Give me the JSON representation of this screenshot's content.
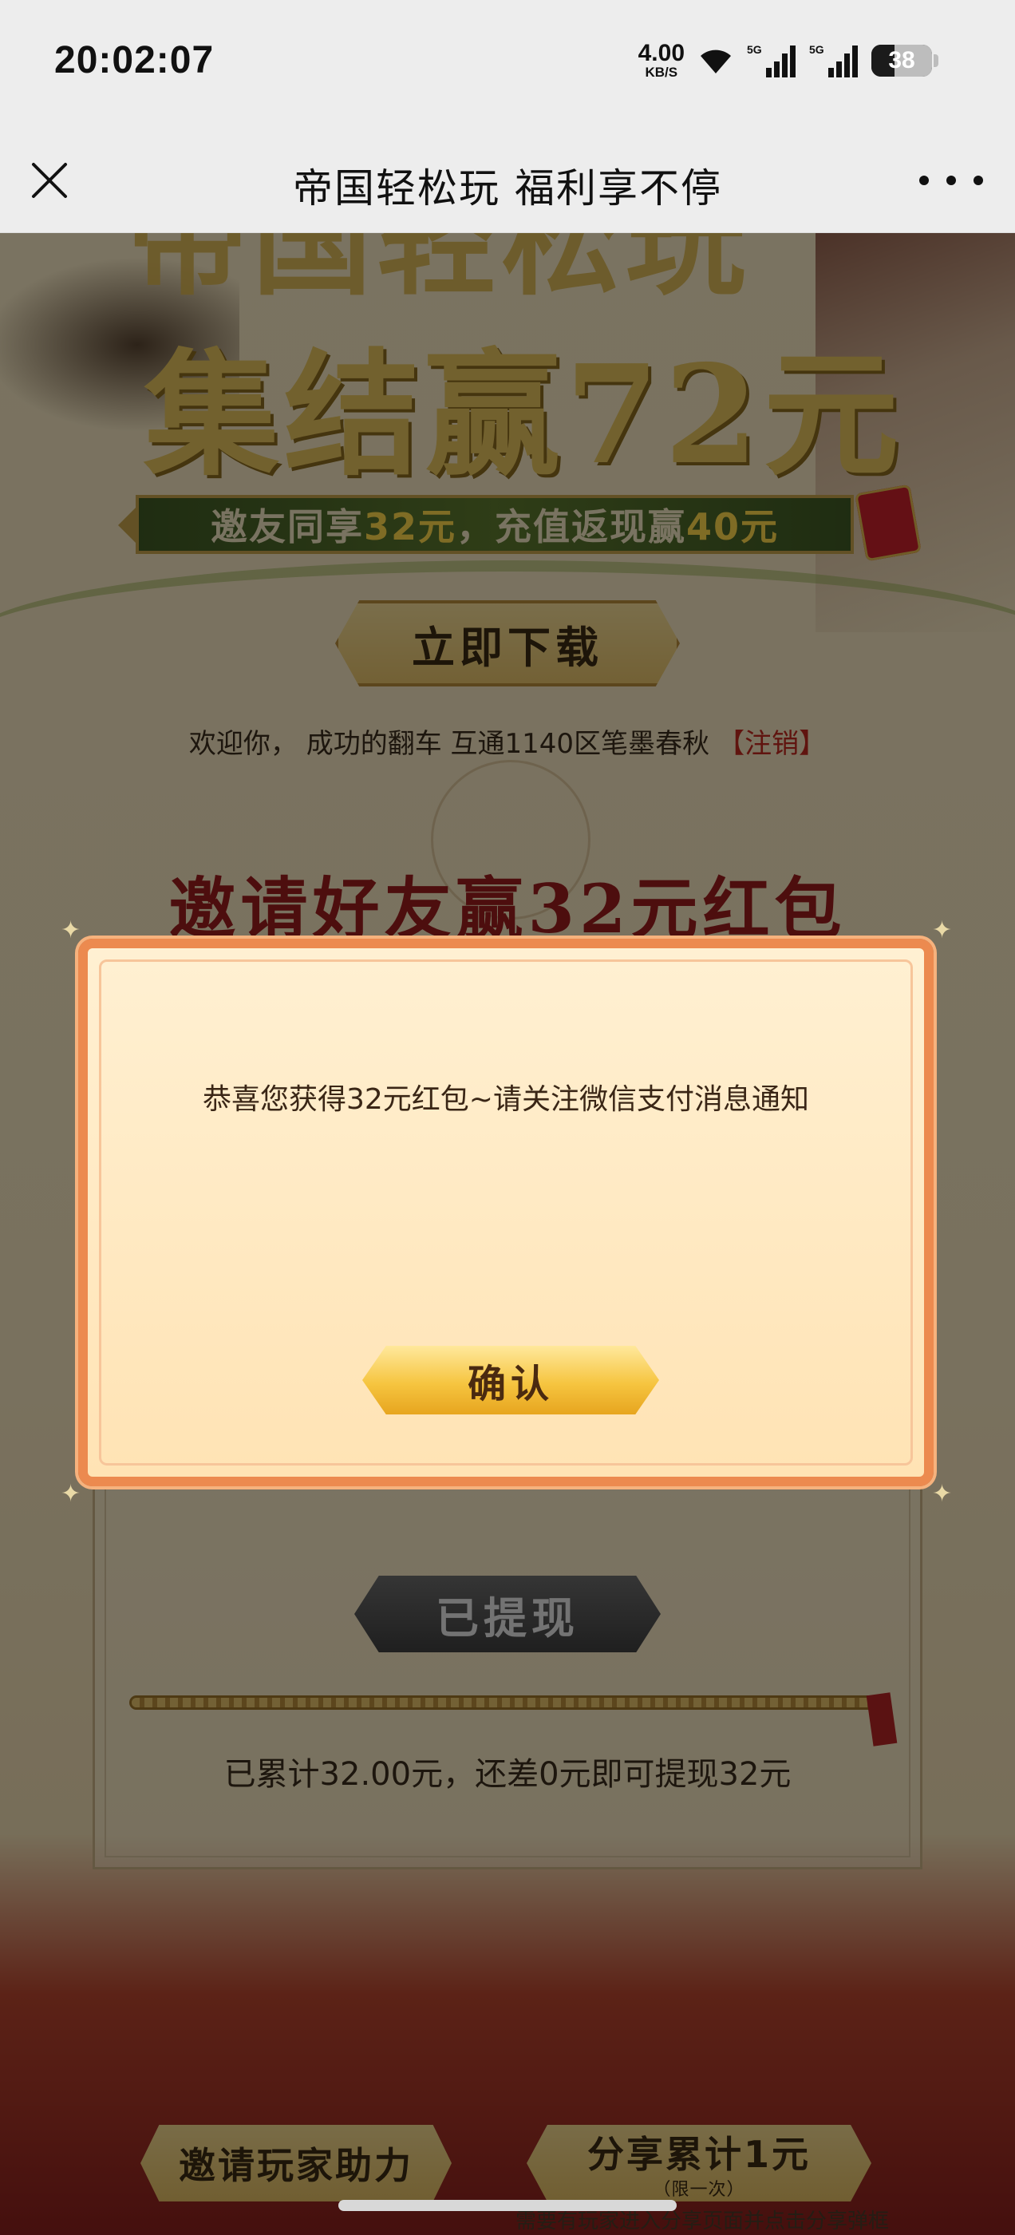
{
  "status_bar": {
    "time": "20:02:07",
    "net_speed_value": "4.00",
    "net_speed_unit": "KB/S",
    "battery": "38",
    "icons": [
      "wifi-icon",
      "signal-5g-icon",
      "signal-5g-icon",
      "battery-icon"
    ]
  },
  "title_bar": {
    "title": "帝国轻松玩 福利享不停",
    "close_icon": "close-icon",
    "more_icon": "more-icon"
  },
  "page": {
    "hero_title_top": "帝国轻松玩",
    "hero_title": "集结赢72元",
    "promo_prefix": "邀友同享",
    "promo_amount1": "32元",
    "promo_middle": "，充值返现赢",
    "promo_amount2": "40元",
    "download_label": "立即下载",
    "welcome_text": "欢迎你， 成功的翻车 互通1140区笔墨春秋",
    "logout_label": "【注销】",
    "invite_heading": "邀请好友赢32元红包",
    "withdrawn_label": "已提现",
    "progress_fraction": 1.0,
    "progress_text": "已累计32.00元，还差0元即可提现32元",
    "help_label": "邀请玩家助力",
    "share_label": "分享累计1元",
    "share_sub": "（限一次）",
    "share_note": "需要有玩家进入分享页面并点击分享弹框中的确认后才算分享成功哦"
  },
  "modal": {
    "message": "恭喜您获得32元红包~请关注微信支付消息通知",
    "confirm_label": "确认"
  },
  "colors": {
    "accent_red": "#9a1c1c",
    "modal_border": "#ec8a4f",
    "confirm_gold": "#f6c540"
  }
}
